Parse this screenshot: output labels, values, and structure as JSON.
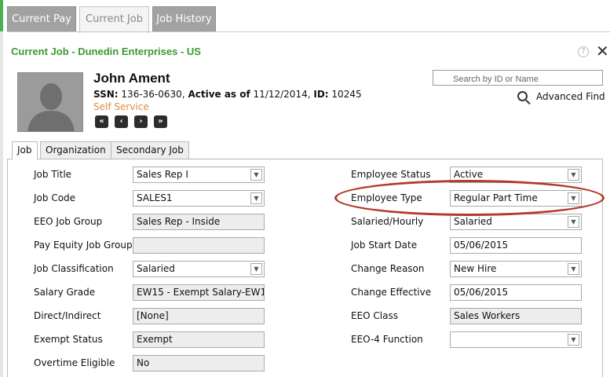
{
  "top_tabs": [
    "Current Pay",
    "Current Job",
    "Job History"
  ],
  "page_title": "Current Job - Dunedin Enterprises - US",
  "employee": {
    "name": "John Ament",
    "ssn_label": "SSN:",
    "ssn": "136-36-0630,",
    "active_label": "Active as of",
    "active_date": "11/12/2014,",
    "id_label": "ID:",
    "id": "10245",
    "self_service": "Self Service"
  },
  "nav": [
    "first-icon",
    "previous-icon",
    "next-icon",
    "last-icon"
  ],
  "search": {
    "placeholder": "Search by ID or Name",
    "advanced_find": "Advanced Find"
  },
  "sub_tabs": [
    "Job",
    "Organization",
    "Secondary Job"
  ],
  "left_fields": [
    {
      "label": "Job Title",
      "value": "Sales Rep I",
      "kind": "select"
    },
    {
      "label": "Job Code",
      "value": "SALES1",
      "kind": "select"
    },
    {
      "label": "EEO Job Group",
      "value": "Sales Rep - Inside",
      "kind": "readonly"
    },
    {
      "label": "Pay Equity Job Group",
      "value": "",
      "kind": "readonly"
    },
    {
      "label": "Job Classification",
      "value": "Salaried",
      "kind": "select"
    },
    {
      "label": "Salary Grade",
      "value": "EW15 - Exempt Salary-EW1",
      "kind": "readonly"
    },
    {
      "label": "Direct/Indirect",
      "value": "[None]",
      "kind": "readonly"
    },
    {
      "label": "Exempt Status",
      "value": "Exempt",
      "kind": "readonly"
    },
    {
      "label": "Overtime Eligible",
      "value": "No",
      "kind": "readonly"
    }
  ],
  "right_fields": [
    {
      "label": "Employee Status",
      "value": "Active",
      "kind": "select"
    },
    {
      "label": "Employee Type",
      "value": "Regular Part Time",
      "kind": "select"
    },
    {
      "label": "Salaried/Hourly",
      "value": "Salaried",
      "kind": "select"
    },
    {
      "label": "Job Start Date",
      "value": "05/06/2015",
      "kind": "input"
    },
    {
      "label": "Change Reason",
      "value": "New Hire",
      "kind": "select"
    },
    {
      "label": "Change Effective",
      "value": "05/06/2015",
      "kind": "input"
    },
    {
      "label": "EEO Class",
      "value": "Sales Workers",
      "kind": "readonly"
    },
    {
      "label": "EEO-4 Function",
      "value": "",
      "kind": "select"
    }
  ],
  "colors": {
    "title_green": "#3a9a2f",
    "link_orange": "#e08a3c",
    "highlight_red": "#b33a2b"
  }
}
